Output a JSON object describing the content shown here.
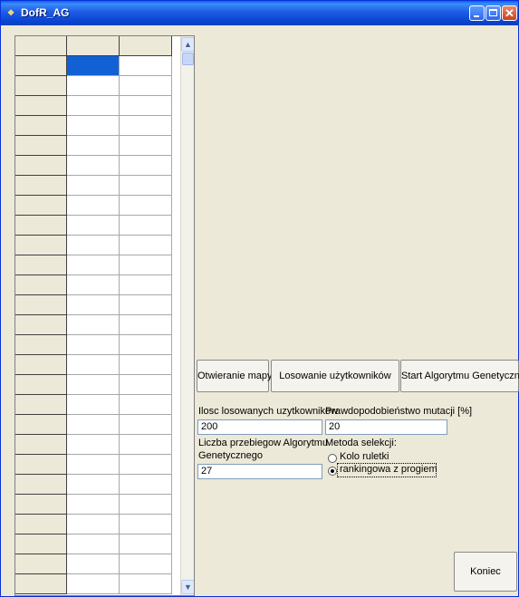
{
  "window": {
    "title": "DofR_AG"
  },
  "buttons": {
    "open_map": "Otwieranie mapy",
    "draw_users": "Losowanie użytkowników",
    "start_ga": "Start Algorytmu Genetycznego",
    "end": "Koniec"
  },
  "form": {
    "users_count_label": "Ilosc losowanych uzytkownikow",
    "users_count_value": "200",
    "mutation_label": "Prawdopodobieństwo mutacji [%]",
    "mutation_value": "20",
    "runs_label_line1": "Liczba przebiegow Algorytmu",
    "runs_label_line2": "Genetycznego",
    "runs_value": "27",
    "selection_label": "Metoda selekcji:",
    "selection_options": [
      {
        "label": "Kolo ruletki",
        "selected": false
      },
      {
        "label": "rankingowa z progiem",
        "selected": true
      }
    ]
  },
  "grid": {
    "columns": 3,
    "visible_rows": 28,
    "selected_cell": "row 1, column 2"
  },
  "colors": {
    "titlebar": "#0A46D2",
    "selection": "#1260D6",
    "window_bg": "#ECE9D8"
  },
  "icons": [
    "app-icon",
    "minimize-icon",
    "maximize-icon",
    "close-icon",
    "scroll-up-icon",
    "scroll-down-icon"
  ]
}
